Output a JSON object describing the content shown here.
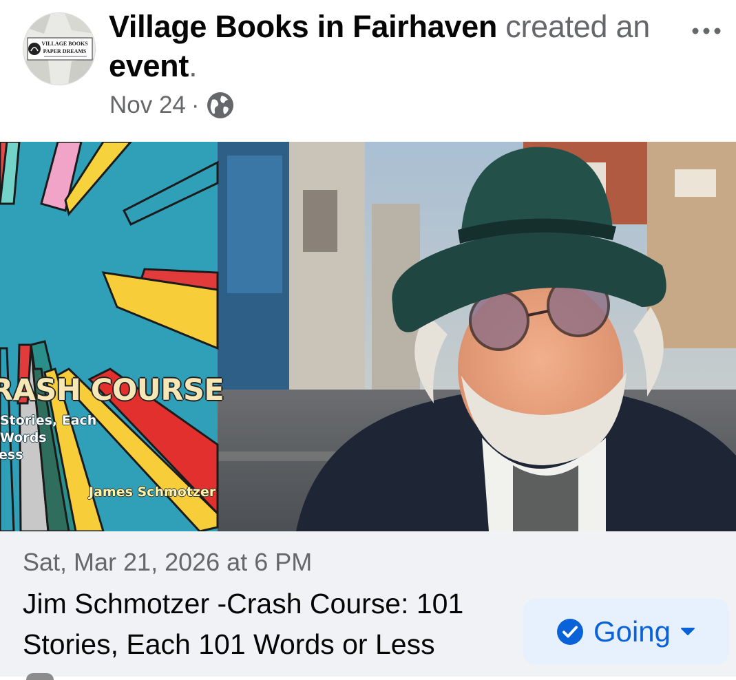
{
  "post": {
    "page_name": "Village Books in Fairhaven",
    "action_text": "created an",
    "object_text": "event",
    "punctuation": ".",
    "date": "Nov 24",
    "separator": "·",
    "visibility_icon": "globe-icon",
    "more_icon": "more-options-icon",
    "avatar_text_1": "VILLAGE BOOKS",
    "avatar_text_2": "PAPER DREAMS"
  },
  "cover": {
    "title": "RASH COURSE",
    "subtitle_1": "Stories, Each",
    "subtitle_2": "Words",
    "subtitle_3": "ess",
    "author": "James Schmotzer"
  },
  "event": {
    "date_time": "Sat, Mar 21, 2026 at 6 PM",
    "title": "Jim Schmotzer -Crash Course: 101 Stories, Each 101 Words or Less",
    "rsvp_label": "Going",
    "rsvp_icon": "check-circle-icon",
    "dropdown_icon": "caret-down-icon"
  },
  "colors": {
    "rsvp_background": "#e7f0fd",
    "rsvp_text": "#0a62d8",
    "card_background": "#f0f2f5",
    "muted_text": "#65676b"
  }
}
